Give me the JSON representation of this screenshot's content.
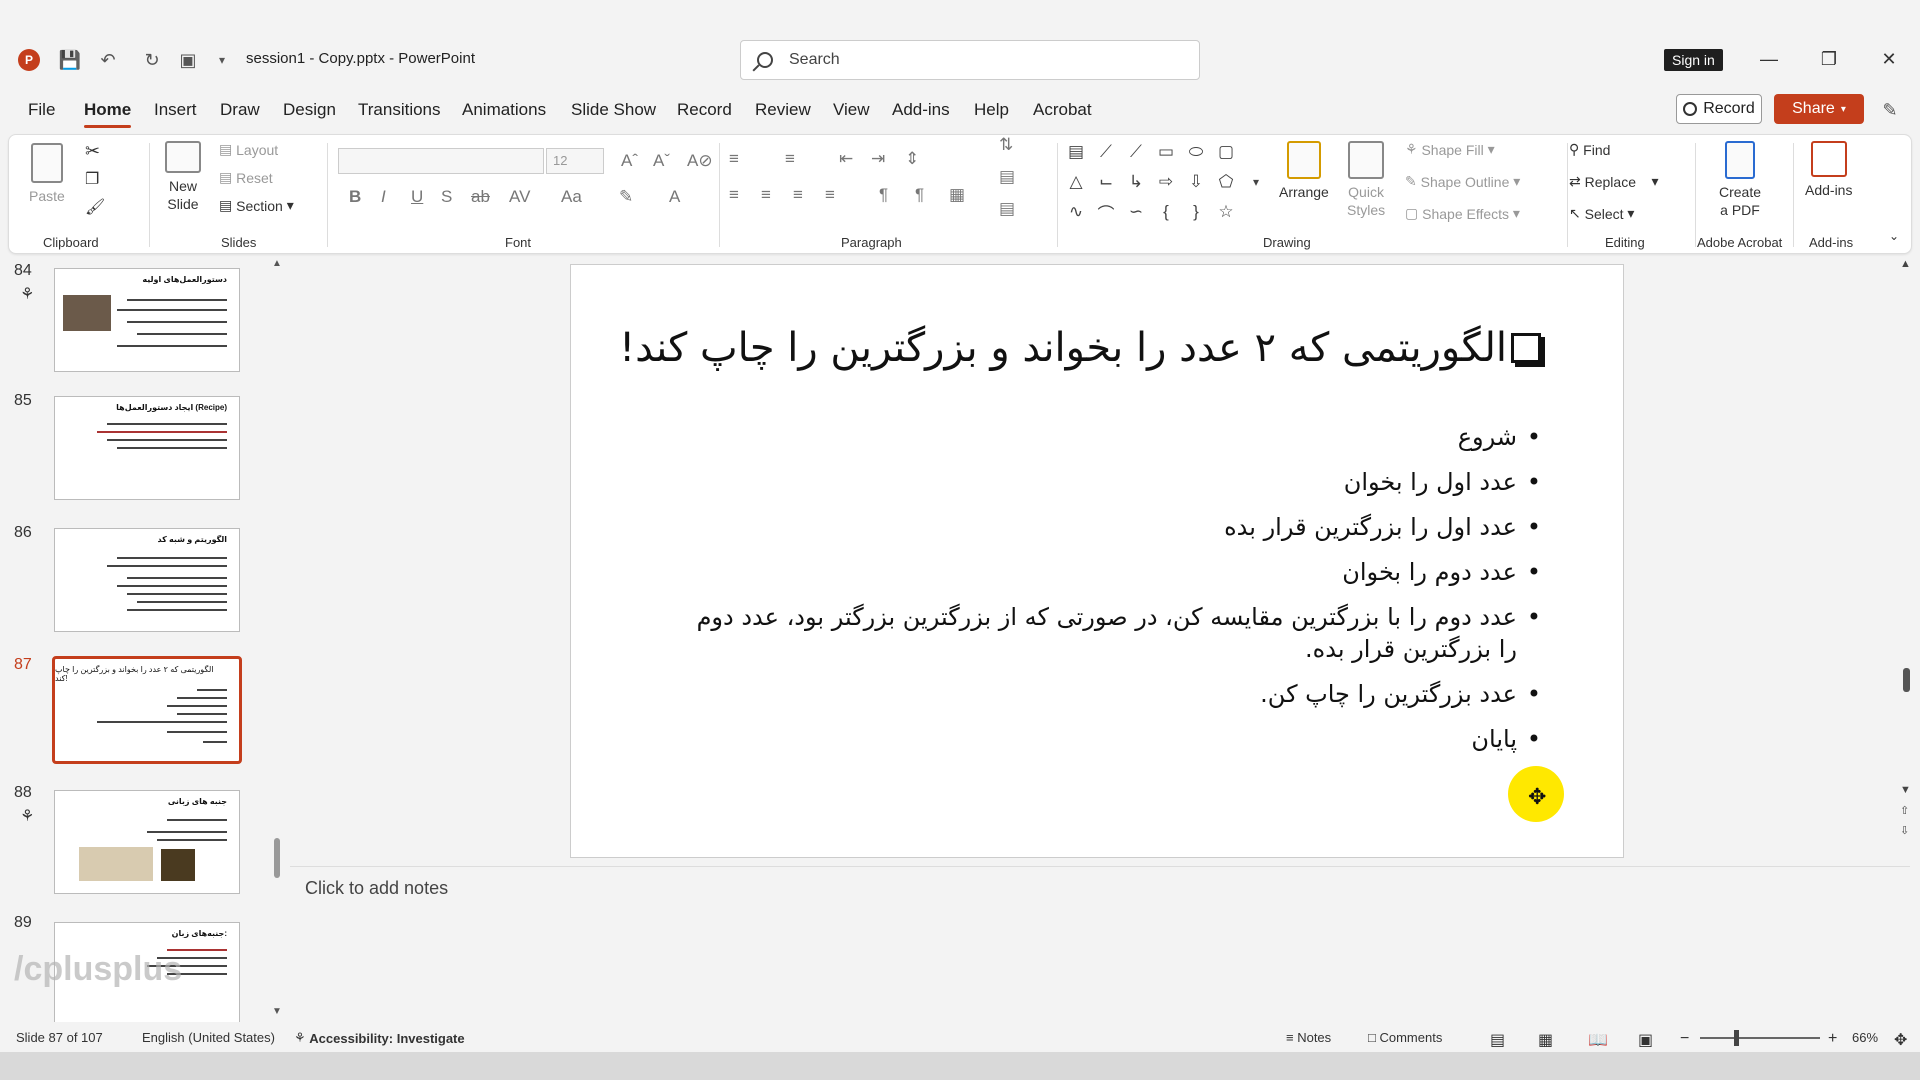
{
  "titlebar": {
    "app_logo": "P",
    "doc_title": "session1 - Copy.pptx  -  PowerPoint",
    "search_placeholder": "Search",
    "sign_in": "Sign in"
  },
  "tabs": [
    "File",
    "Home",
    "Insert",
    "Draw",
    "Design",
    "Transitions",
    "Animations",
    "Slide Show",
    "Record",
    "Review",
    "View",
    "Add-ins",
    "Help",
    "Acrobat"
  ],
  "active_tab": "Home",
  "record_btn": "Record",
  "share_btn": "Share",
  "ribbon": {
    "clipboard": {
      "paste": "Paste",
      "label": "Clipboard"
    },
    "slides": {
      "new_slide_1": "New",
      "new_slide_2": "Slide",
      "layout": "Layout",
      "reset": "Reset",
      "section": "Section",
      "label": "Slides"
    },
    "font": {
      "size": "12",
      "label": "Font"
    },
    "paragraph": {
      "label": "Paragraph"
    },
    "drawing": {
      "arrange": "Arrange",
      "quick_styles_1": "Quick",
      "quick_styles_2": "Styles",
      "shape_fill": "Shape Fill",
      "shape_outline": "Shape Outline",
      "shape_effects": "Shape Effects",
      "label": "Drawing"
    },
    "editing": {
      "find": "Find",
      "replace": "Replace",
      "select": "Select",
      "label": "Editing"
    },
    "acrobat": {
      "create_1": "Create",
      "create_2": "a PDF",
      "label": "Adobe Acrobat"
    },
    "addins": {
      "addins": "Add-ins",
      "label": "Add-ins"
    }
  },
  "thumbnails": [
    {
      "num": "84",
      "title": "دستورالعمل‌های اولیه"
    },
    {
      "num": "85",
      "title": "ایجاد دستورالعمل‌ها (Recipe)"
    },
    {
      "num": "86",
      "title": "الگوریتم و شبه کد"
    },
    {
      "num": "87",
      "title": "الگوریتمی که ۲ عدد را بخواند و بزرگترین را چاپ کند!"
    },
    {
      "num": "88",
      "title": "جنبه های زبانی"
    },
    {
      "num": "89",
      "title": "جنبه‌های زبان:"
    }
  ],
  "active_slide": "87",
  "watermark": "/cplusplus",
  "slide": {
    "title": "الگوریتمی که ۲ عدد را بخواند و بزرگترین را چاپ کند!",
    "bullets": [
      "شروع",
      "عدد اول را بخوان",
      "عدد اول را بزرگترین قرار بده",
      "عدد دوم را بخوان",
      "عدد دوم را با بزرگترین مقایسه کن، در صورتی که از بزرگترین بزرگتر بود، عدد دوم را بزرگترین قرار بده.",
      "عدد بزرگترین را چاپ کن.",
      "پایان"
    ]
  },
  "notes_placeholder": "Click to add notes",
  "statusbar": {
    "slide_count": "Slide 87 of 107",
    "language": "English (United States)",
    "accessibility": "Accessibility: Investigate",
    "notes": "Notes",
    "comments": "Comments",
    "zoom": "66%"
  },
  "colors": {
    "accent": "#c43e1c",
    "highlight": "#ffe800"
  }
}
